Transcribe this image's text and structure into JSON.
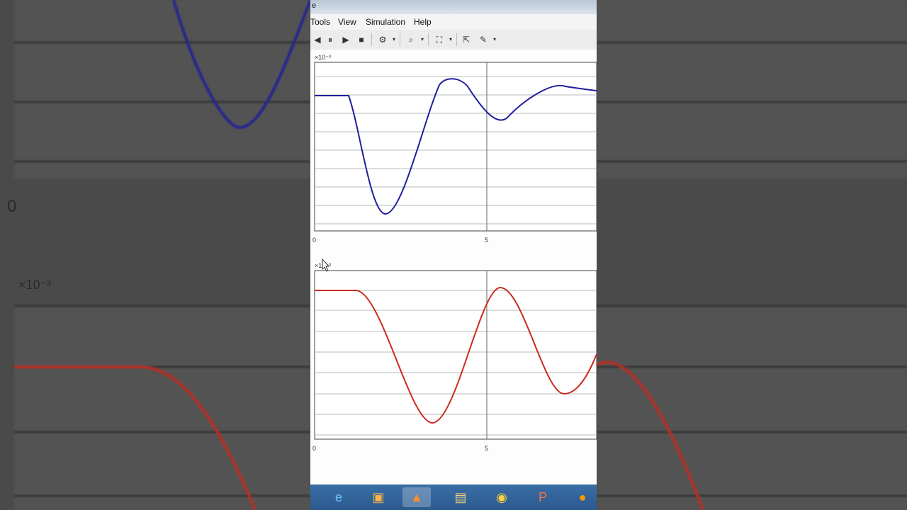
{
  "window": {
    "title_fragment": "e"
  },
  "menu": [
    "Tools",
    "View",
    "Simulation",
    "Help"
  ],
  "toolbar_icons": [
    "step-back-icon",
    "pause-icon",
    "play-icon",
    "stop-icon",
    "signal-select-icon",
    "zoom-icon",
    "autoscale-icon",
    "restore-icon",
    "parameters-icon"
  ],
  "scope1": {
    "exponent_label": "×10⁻³",
    "x_tick_0": "0",
    "x_tick_5": "5",
    "color": "#1f1f9e"
  },
  "scope2": {
    "exponent_label": "×10⁻³",
    "x_tick_0": "0",
    "x_tick_5": "5",
    "color": "#cc2a1e"
  },
  "background": {
    "zero_label": "0",
    "exponent_label": "×10⁻³"
  },
  "taskbar": [
    "ie-icon",
    "media-player-icon",
    "matlab-icon",
    "file-explorer-icon",
    "chrome-icon",
    "powerpoint-icon",
    "firefox-icon"
  ]
}
